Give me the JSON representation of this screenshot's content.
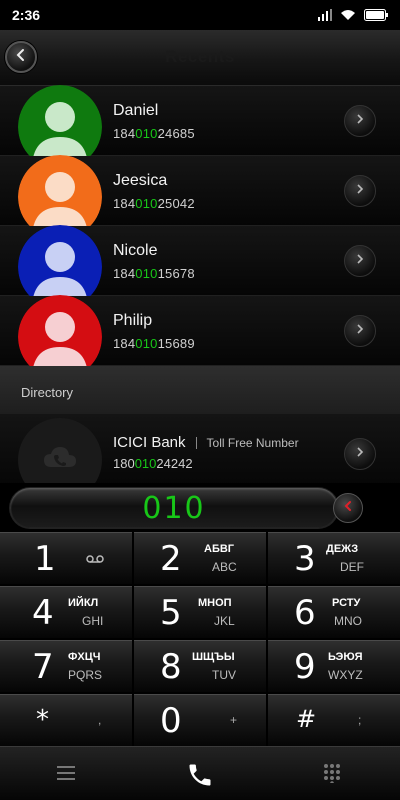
{
  "status_bar": {
    "time": "2:36"
  },
  "header": {
    "title": "Recents"
  },
  "contacts": [
    {
      "name": "Daniel",
      "number_prefix": "184",
      "number_match": "010",
      "number_suffix": "24685",
      "avatar_color": "#0f7a0f"
    },
    {
      "name": "Jeesica",
      "number_prefix": "184",
      "number_match": "010",
      "number_suffix": "25042",
      "avatar_color": "#f26c1a"
    },
    {
      "name": "Nicole",
      "number_prefix": "184",
      "number_match": "010",
      "number_suffix": "15678",
      "avatar_color": "#0a1fb5"
    },
    {
      "name": "Philip",
      "number_prefix": "184",
      "number_match": "010",
      "number_suffix": "15689",
      "avatar_color": "#d40d12"
    }
  ],
  "directory": {
    "section_label": "Directory",
    "item": {
      "name": "ICICI Bank",
      "label": "Toll Free Number",
      "number_prefix": "180",
      "number_match": "010",
      "number_suffix": "24242"
    }
  },
  "dial_input": {
    "value": "010"
  },
  "keypad": {
    "keys": [
      {
        "digit": "1",
        "cyrillic": "",
        "latin": "",
        "sub": "voicemail-icon"
      },
      {
        "digit": "2",
        "cyrillic": "АБВГ",
        "latin": "ABC",
        "sub": ""
      },
      {
        "digit": "3",
        "cyrillic": "ДЕЖЗ",
        "latin": "DEF",
        "sub": ""
      },
      {
        "digit": "4",
        "cyrillic": "ИЙКЛ",
        "latin": "GHI",
        "sub": ""
      },
      {
        "digit": "5",
        "cyrillic": "МНОП",
        "latin": "JKL",
        "sub": ""
      },
      {
        "digit": "6",
        "cyrillic": "РСТУ",
        "latin": "MNO",
        "sub": ""
      },
      {
        "digit": "7",
        "cyrillic": "ФХЦЧ",
        "latin": "PQRS",
        "sub": ""
      },
      {
        "digit": "8",
        "cyrillic": "ШЩЪЫ",
        "latin": "TUV",
        "sub": ""
      },
      {
        "digit": "9",
        "cyrillic": "ЬЭЮЯ",
        "latin": "WXYZ",
        "sub": ""
      },
      {
        "digit": "*",
        "cyrillic": "",
        "latin": "",
        "sub": ","
      },
      {
        "digit": "0",
        "cyrillic": "",
        "latin": "",
        "sub": "+"
      },
      {
        "digit": "#",
        "cyrillic": "",
        "latin": "",
        "sub": ";"
      }
    ]
  },
  "colors": {
    "highlight": "#18c718",
    "background": "#000000"
  }
}
